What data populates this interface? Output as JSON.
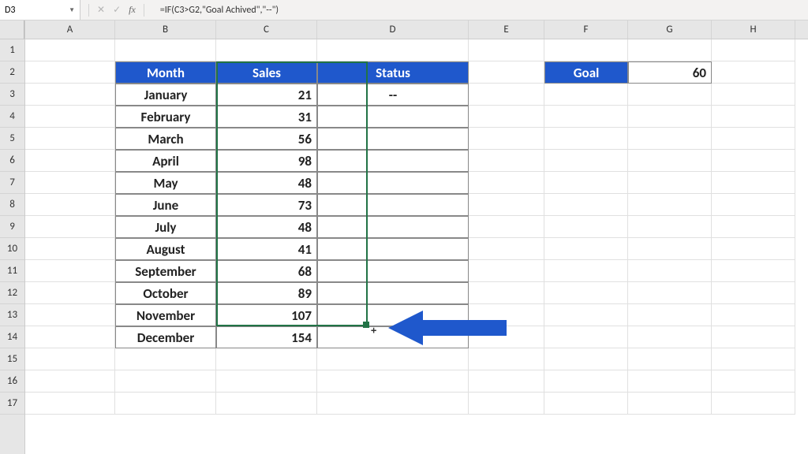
{
  "nameBox": "D3",
  "formula": "=IF(C3>G2,\"Goal Achived\",\"--\")",
  "columns": [
    "A",
    "B",
    "C",
    "D",
    "E",
    "F",
    "G",
    "H"
  ],
  "rowCount": 17,
  "table": {
    "headers": {
      "month": "Month",
      "sales": "Sales",
      "status": "Status"
    },
    "rows": [
      {
        "month": "January",
        "sales": "21",
        "status": "--"
      },
      {
        "month": "February",
        "sales": "31",
        "status": ""
      },
      {
        "month": "March",
        "sales": "56",
        "status": ""
      },
      {
        "month": "April",
        "sales": "98",
        "status": ""
      },
      {
        "month": "May",
        "sales": "48",
        "status": ""
      },
      {
        "month": "June",
        "sales": "73",
        "status": ""
      },
      {
        "month": "July",
        "sales": "48",
        "status": ""
      },
      {
        "month": "August",
        "sales": "41",
        "status": ""
      },
      {
        "month": "September",
        "sales": "68",
        "status": ""
      },
      {
        "month": "October",
        "sales": "89",
        "status": ""
      },
      {
        "month": "November",
        "sales": "107",
        "status": ""
      },
      {
        "month": "December",
        "sales": "154",
        "status": ""
      }
    ]
  },
  "goal": {
    "label": "Goal",
    "value": "60"
  },
  "colors": {
    "headerBlue": "#1f58cc",
    "arrow": "#1f58cc",
    "selection": "#217346"
  }
}
